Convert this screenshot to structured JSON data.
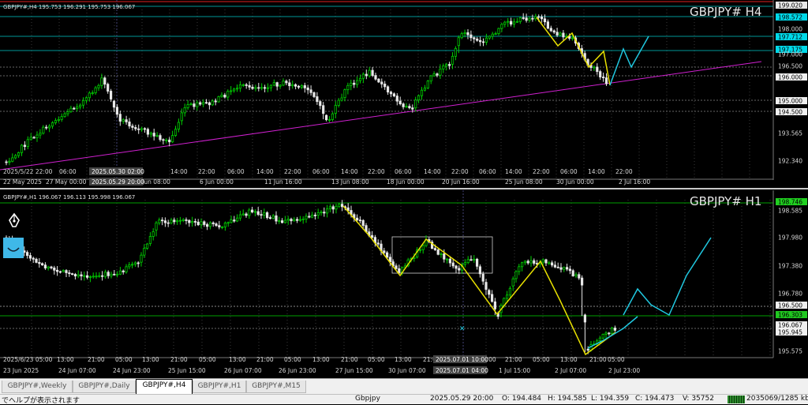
{
  "top_chart": {
    "header": "GBPJPY#,H4  195.753 196.291 195.753 196.067",
    "symbol": "GBPJPY# H4",
    "price_labels": [
      "199.020",
      "198.572",
      "198.000",
      "197.712",
      "197.175",
      "197.000",
      "196.500",
      "196.000",
      "195.000",
      "194.500",
      "193.565",
      "192.340"
    ],
    "time_labels": [
      "2025/5/22 22:00",
      "22 May 2025",
      "06:00",
      "27 May 00:00",
      "14:00",
      "2025.05.30 02:00",
      "2025.05.29 20:00",
      "3 Jun 08:00",
      "14:00",
      "22:00",
      "6 Jun 00:00",
      "06:00",
      "14:00",
      "22:00",
      "06:00",
      "11 Jun 16:00",
      "13 Jun 08:00",
      "14:00",
      "22:00",
      "06:00",
      "18 Jun 00:00",
      "14:00",
      "22:00",
      "20 Jun 16:00",
      "06:00",
      "14:00",
      "25 Jun 08:00",
      "22:00",
      "06:00",
      "30 Jun 00:00",
      "14:00",
      "22:00",
      "2 Jul 16:00"
    ]
  },
  "bottom_chart": {
    "header": "GBPJPY#,H1  196.067 196.113 195.998 196.067",
    "symbol": "GBPJPY# H1",
    "price_labels": [
      "198.746",
      "198.585",
      "197.980",
      "197.380",
      "196.780",
      "196.500",
      "196.303",
      "196.067",
      "195.945",
      "195.575"
    ],
    "time_labels": [
      "2025/6/23 05:00",
      "13:00",
      "21:00",
      "05:00",
      "13:00",
      "21:00",
      "05:00",
      "13:00",
      "21:00",
      "05:00",
      "13:00",
      "21:00",
      "05:00",
      "13:00",
      "21:00",
      "05:00",
      "13:00",
      "21:00",
      "2025.07.01 10:00",
      "2025.07.01 04:00",
      "21:00",
      "05:00",
      "13:00",
      "21:00",
      "05:00",
      "23 Jun 2025",
      "24 Jun 07:00",
      "24 Jun 23:00",
      "25 Jun 15:00",
      "26 Jun 07:00",
      "26 Jun 23:00",
      "27 Jun 15:00",
      "30 Jun 07:00",
      "1 Jul 15:00",
      "2 Jul 07:00",
      "2 Jul 23:00"
    ]
  },
  "tabs": [
    "GBPJPY#,Weekly",
    "GBPJPY#,Daily",
    "GBPJPY#,H4",
    "GBPJPY#,H1",
    "GBPJPY#,M15"
  ],
  "status": {
    "help": "でヘルプが表示されます",
    "symbol": "Gbpjpy",
    "datetime": "2025.05.29 20:00",
    "open": "O: 194.484",
    "high": "H: 194.585",
    "low": "L: 194.359",
    "close": "C: 194.473",
    "volume": "V: 35752",
    "traffic": "2035069/1285 kb"
  },
  "colors": {
    "bull": "#00d000",
    "bear": "#e8e8e8",
    "trend": "#d020d0",
    "zigzag": "#e8e000",
    "forecast": "#20c8e0",
    "hline": "#00c8c8",
    "greenline": "#00a000"
  }
}
